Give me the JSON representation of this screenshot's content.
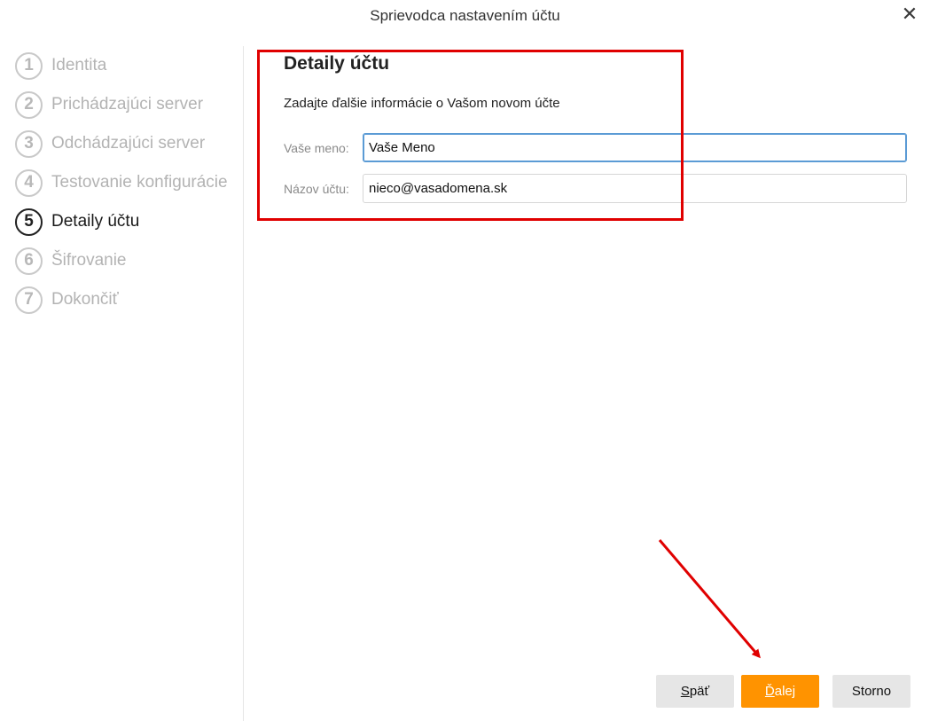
{
  "window": {
    "title": "Sprievodca nastavením účtu",
    "close_icon": "close-icon"
  },
  "steps": [
    {
      "num": "1",
      "label": "Identita",
      "active": false
    },
    {
      "num": "2",
      "label": "Prichádzajúci server",
      "active": false
    },
    {
      "num": "3",
      "label": "Odchádzajúci server",
      "active": false
    },
    {
      "num": "4",
      "label": "Testovanie konfigurácie",
      "active": false
    },
    {
      "num": "5",
      "label": "Detaily účtu",
      "active": true
    },
    {
      "num": "6",
      "label": "Šifrovanie",
      "active": false
    },
    {
      "num": "7",
      "label": "Dokončiť",
      "active": false
    }
  ],
  "main": {
    "heading": "Detaily účtu",
    "subtitle": "Zadajte ďalšie informácie o Vašom novom účte",
    "fields": {
      "name": {
        "label": "Vaše meno:",
        "value": "Vaše Meno"
      },
      "account": {
        "label": "Názov účtu:",
        "value": "nieco@vasadomena.sk"
      }
    }
  },
  "buttons": {
    "back": {
      "accel": "S",
      "rest": "päť"
    },
    "next": {
      "accel": "Ď",
      "rest": "alej"
    },
    "cancel": "Storno"
  },
  "colors": {
    "accent": "#ff9300",
    "annotation": "#e00000"
  }
}
